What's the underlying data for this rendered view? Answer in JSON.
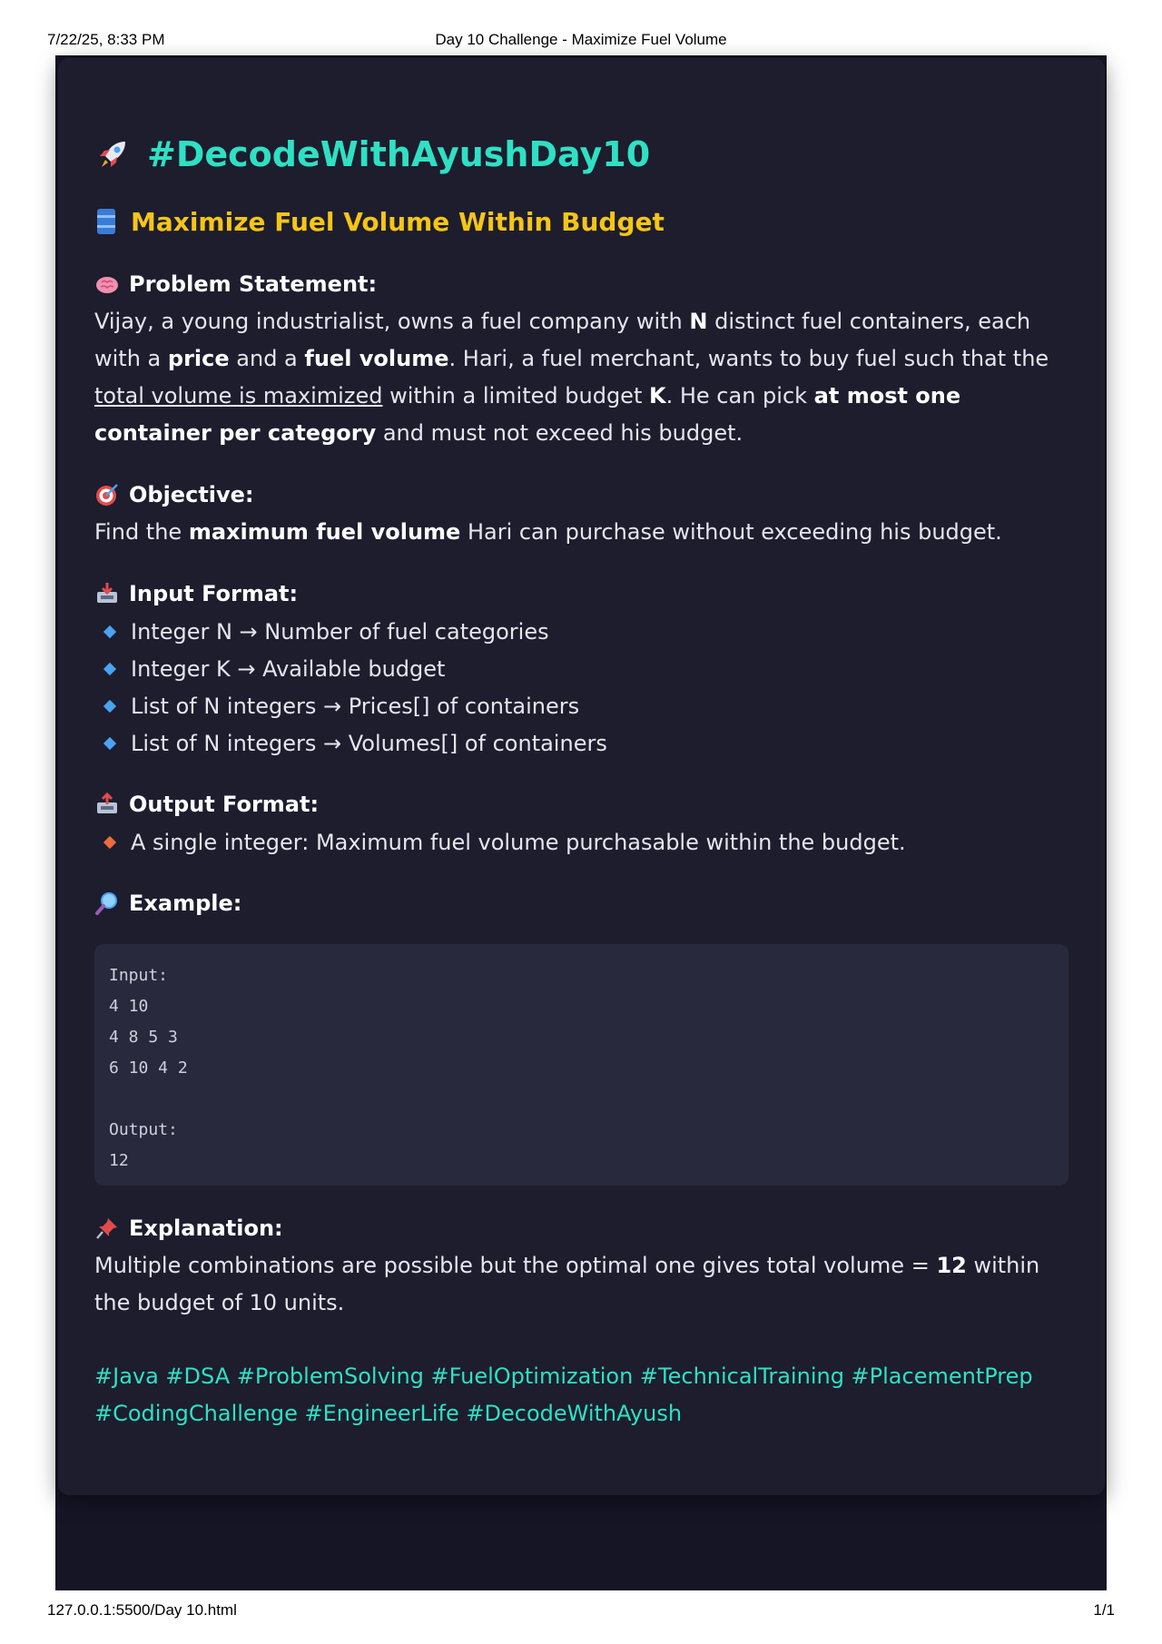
{
  "print_header": {
    "datetime": "7/22/25, 8:33 PM",
    "title": "Day 10 Challenge - Maximize Fuel Volume"
  },
  "print_footer": {
    "url": "127.0.0.1:5500/Day 10.html",
    "page": "1/1"
  },
  "colors": {
    "accent": "#2fe0c4",
    "subtitle": "#f5c518",
    "card_bg": "#1d1d2e",
    "code_bg": "#29293d"
  },
  "title": {
    "icon": "rocket-icon",
    "text": "#DecodeWithAyushDay10"
  },
  "subtitle": {
    "icon": "barrel-icon",
    "text": "Maximize Fuel Volume Within Budget"
  },
  "problem": {
    "icon": "brain-icon",
    "heading": "Problem Statement:",
    "p1": "Vijay, a young industrialist, owns a fuel company with ",
    "b1": "N",
    "p2": " distinct fuel containers, each with a ",
    "b2": "price",
    "p3": " and a ",
    "b3": "fuel volume",
    "p4": ". Hari, a fuel merchant, wants to buy fuel such that the ",
    "u1": "total volume is maximized",
    "p5": " within a limited budget ",
    "b4": "K",
    "p6": ". He can pick ",
    "b5": "at most one container per category",
    "p7": " and must not exceed his budget."
  },
  "objective": {
    "icon": "target-icon",
    "heading": "Objective:",
    "p1": "Find the ",
    "b1": "maximum fuel volume",
    "p2": " Hari can purchase without exceeding his budget."
  },
  "input_format": {
    "icon": "inbox-tray-icon",
    "heading": "Input Format:",
    "items": [
      "Integer N → Number of fuel categories",
      "Integer K → Available budget",
      "List of N integers → Prices[] of containers",
      "List of N integers → Volumes[] of containers"
    ]
  },
  "output_format": {
    "icon": "outbox-tray-icon",
    "heading": "Output Format:",
    "items": [
      "A single integer: Maximum fuel volume purchasable within the budget."
    ]
  },
  "example": {
    "icon": "magnifier-icon",
    "heading": "Example:",
    "code": "Input:\n4 10\n4 8 5 3\n6 10 4 2\n\nOutput:\n12"
  },
  "explanation": {
    "icon": "pushpin-icon",
    "heading": "Explanation:",
    "p1": "Multiple combinations are possible but the optimal one gives total volume = ",
    "b1": "12",
    "p2": " within the budget of 10 units."
  },
  "hashtags": "#Java #DSA #ProblemSolving #FuelOptimization #TechnicalTraining #PlacementPrep #CodingChallenge #EngineerLife #DecodeWithAyush"
}
